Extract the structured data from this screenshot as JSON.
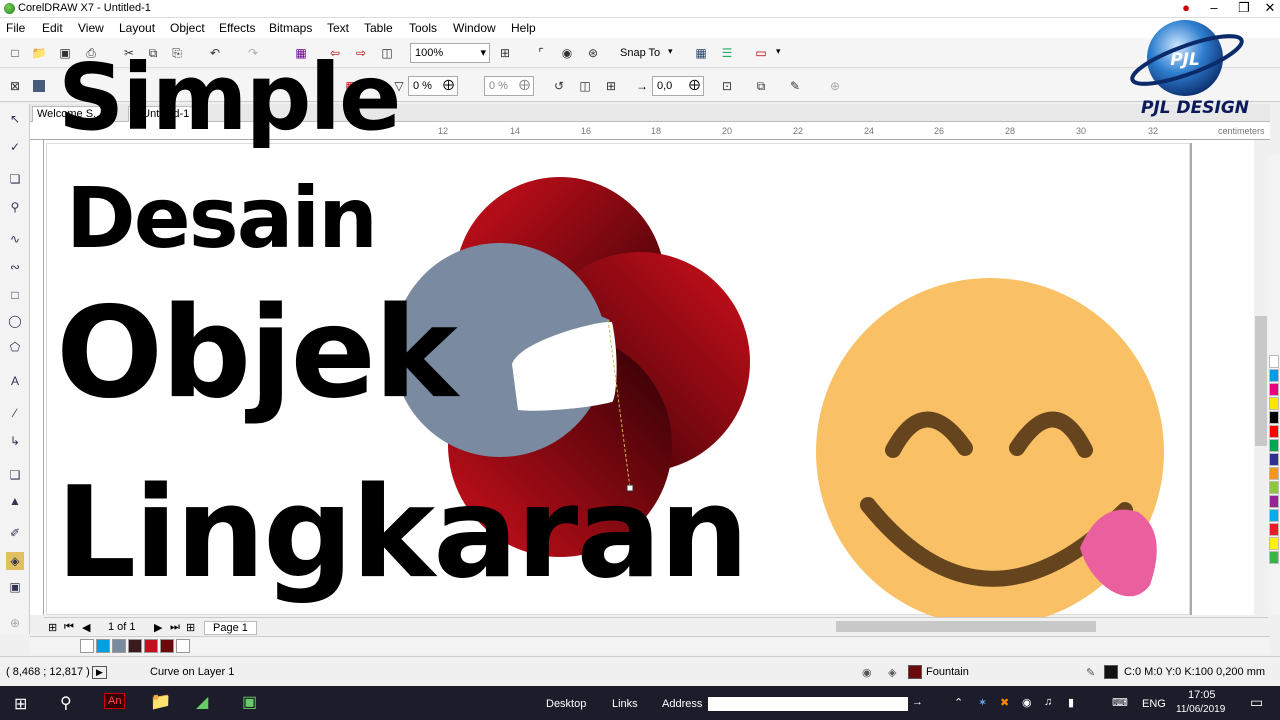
{
  "window": {
    "title": "CorelDRAW X7 - Untitled-1"
  },
  "menu": [
    "File",
    "Edit",
    "View",
    "Layout",
    "Object",
    "Effects",
    "Bitmaps",
    "Text",
    "Table",
    "Tools",
    "Window",
    "Help"
  ],
  "toolbar": {
    "zoom": "100%",
    "snap_to": "Snap To"
  },
  "property_bar": {
    "transparency_1": "0 %",
    "transparency_2": "0 %",
    "offset": "0,0"
  },
  "doc_tabs": {
    "welcome": "Welcome S...",
    "untitled": "...Untitled-1"
  },
  "ruler": {
    "ticks": [
      "12",
      "14",
      "16",
      "18",
      "20",
      "22",
      "24",
      "26",
      "28",
      "30",
      "32"
    ],
    "units": "centimeters"
  },
  "overlay": {
    "line1": "Simple",
    "line2": "Desain",
    "line3": "Objek",
    "line4": "Lingkaran"
  },
  "logo": {
    "monogram": "PJL",
    "brand": "PJL DESIGN"
  },
  "page_nav": {
    "page_count": "1 of 1",
    "page_tab": "Page 1"
  },
  "status": {
    "coords": "( 8,468 ; 12,817 )",
    "object_info": "Curve on Layer 1",
    "fill_type": "Fountain",
    "outline_info": "C:0 M:0 Y:0 K:100  0,200 mm"
  },
  "taskbar": {
    "toolbars": [
      "Desktop",
      "Links",
      "Address"
    ],
    "language": "ENG",
    "time": "17:05",
    "date": "11/06/2019"
  },
  "colors": {
    "accent_red": "#c0121e",
    "gray_blue": "#7a8aa0",
    "emoji_face": "#f9c065",
    "emoji_feature": "#66451e",
    "tongue": "#ea5f9e"
  },
  "palette": [
    "#ffffff",
    "#00a0e0",
    "#e8007e",
    "#ffe600",
    "#000000",
    "#ff0000",
    "#00a651",
    "#2e3192",
    "#f7941d",
    "#8dc63f",
    "#92278f",
    "#00aeef",
    "#ed1c24",
    "#fff200",
    "#39b54a"
  ],
  "doc_palette": [
    "#00a0e0",
    "#7a8aa0",
    "#3a1a1a",
    "#c0121e",
    "#6a0a0a",
    "#ffffff"
  ]
}
